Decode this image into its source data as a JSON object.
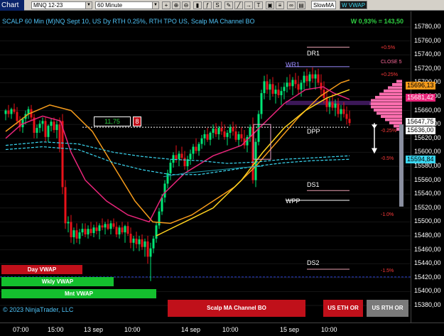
{
  "toolbar": {
    "chart_label": "Chart",
    "instrument": "MNQ 12-23",
    "interval": "60 Minute",
    "tags": [
      "SlowMA",
      "W VWAP"
    ]
  },
  "chart": {
    "title": "SCALP 60 Min (M)NQ Sept 10, US Dy RTH 0.25%, RTH TPO US, Scalp MA Channel BO",
    "pnl": "W 0,93% = 143,50",
    "box_value": "11,75",
    "box_count": "8",
    "levels": {
      "dr1": "DR1",
      "wr1": "WR1",
      "close": "CLOSE 5",
      "dpp": "DPP",
      "ds1": "DS1",
      "wpp": "WPP",
      "ds2": "DS2"
    },
    "pcts": {
      "p05": "+0.5%",
      "p025": "+0.25%",
      "m025": "-0.25%",
      "m05": "-0.5%",
      "m1": "-1.0%",
      "m15": "-1.5%"
    },
    "vwap": {
      "day": "Day VWAP",
      "wkly": "Wkly VWAP",
      "mnt": "Mnt VWAP"
    },
    "copyright": "© 2023 NinjaTrader, LLC",
    "footer_buttons": {
      "bo": "Scalp MA Channel BO",
      "eth": "US ETH OR",
      "rth": "US RTH OR"
    }
  },
  "price_axis": {
    "ticks": [
      "15780,00",
      "15760,00",
      "15740,00",
      "15720,00",
      "15700,00",
      "15680,00",
      "15660,00",
      "15640,00",
      "15620,00",
      "15600,00",
      "15580,00",
      "15560,00",
      "15540,00",
      "15520,00",
      "15500,00",
      "15480,00",
      "15460,00",
      "15440,00",
      "15420,00",
      "15400,00",
      "15380,00"
    ],
    "badges": {
      "b1": "15696,13",
      "b2": "15681,42",
      "b3": "15647,75",
      "b4": "15636,00",
      "b5": "15594,84"
    }
  },
  "time_axis": {
    "ticks": [
      "07:00",
      "15:00",
      "13 sep",
      "10:00",
      "14 sep",
      "10:00",
      "15 sep",
      "10:00"
    ]
  },
  "colors": {
    "up": "#00e676",
    "down": "#e8121a",
    "ma_orange": "#f59b1b",
    "ma_yellow": "#ffd21f",
    "ma_pink": "#e8257a",
    "vwap_cyan": "#3ad6f0",
    "profile": "#ff6fb0"
  }
}
